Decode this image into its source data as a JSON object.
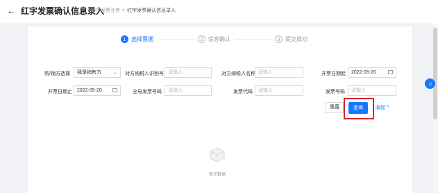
{
  "header": {
    "back_icon": "←",
    "title": "红字发票确认信息录入",
    "breadcrumb": [
      "红字发票业务",
      "红字发票确认信息录入"
    ],
    "breadcrumb_sep": ">"
  },
  "steps": [
    {
      "num": "1",
      "label": "选择票据",
      "active": true
    },
    {
      "num": "2",
      "label": "信息确认",
      "active": false
    },
    {
      "num": "3",
      "label": "提交成功",
      "active": false
    }
  ],
  "form": {
    "buyer_seller_label": "购/销方选择",
    "buyer_seller_value": "我是销售方",
    "counterparty_taxid_label": "对方纳税人识别号",
    "counterparty_taxid_placeholder": "请输入",
    "counterparty_name_label": "对方纳税人名称",
    "counterparty_name_placeholder": "请输入",
    "issue_date_start_label": "开票日期起",
    "issue_date_start_value": "2022-05-20",
    "issue_date_end_label": "开票日期止",
    "issue_date_end_value": "2022-05-20",
    "ecode_label": "全电发票号码",
    "ecode_placeholder": "请输入",
    "invoice_code_label": "发票代码",
    "invoice_code_placeholder": "请输入",
    "invoice_number_label": "发票号码",
    "invoice_number_placeholder": "请输入"
  },
  "actions": {
    "reset_label": "重置",
    "query_label": "查询",
    "collapse_label": "收起",
    "collapse_icon": "^"
  },
  "empty": {
    "text": "暂无数据"
  },
  "colors": {
    "primary": "#1677ff",
    "highlight": "#d9262c"
  }
}
